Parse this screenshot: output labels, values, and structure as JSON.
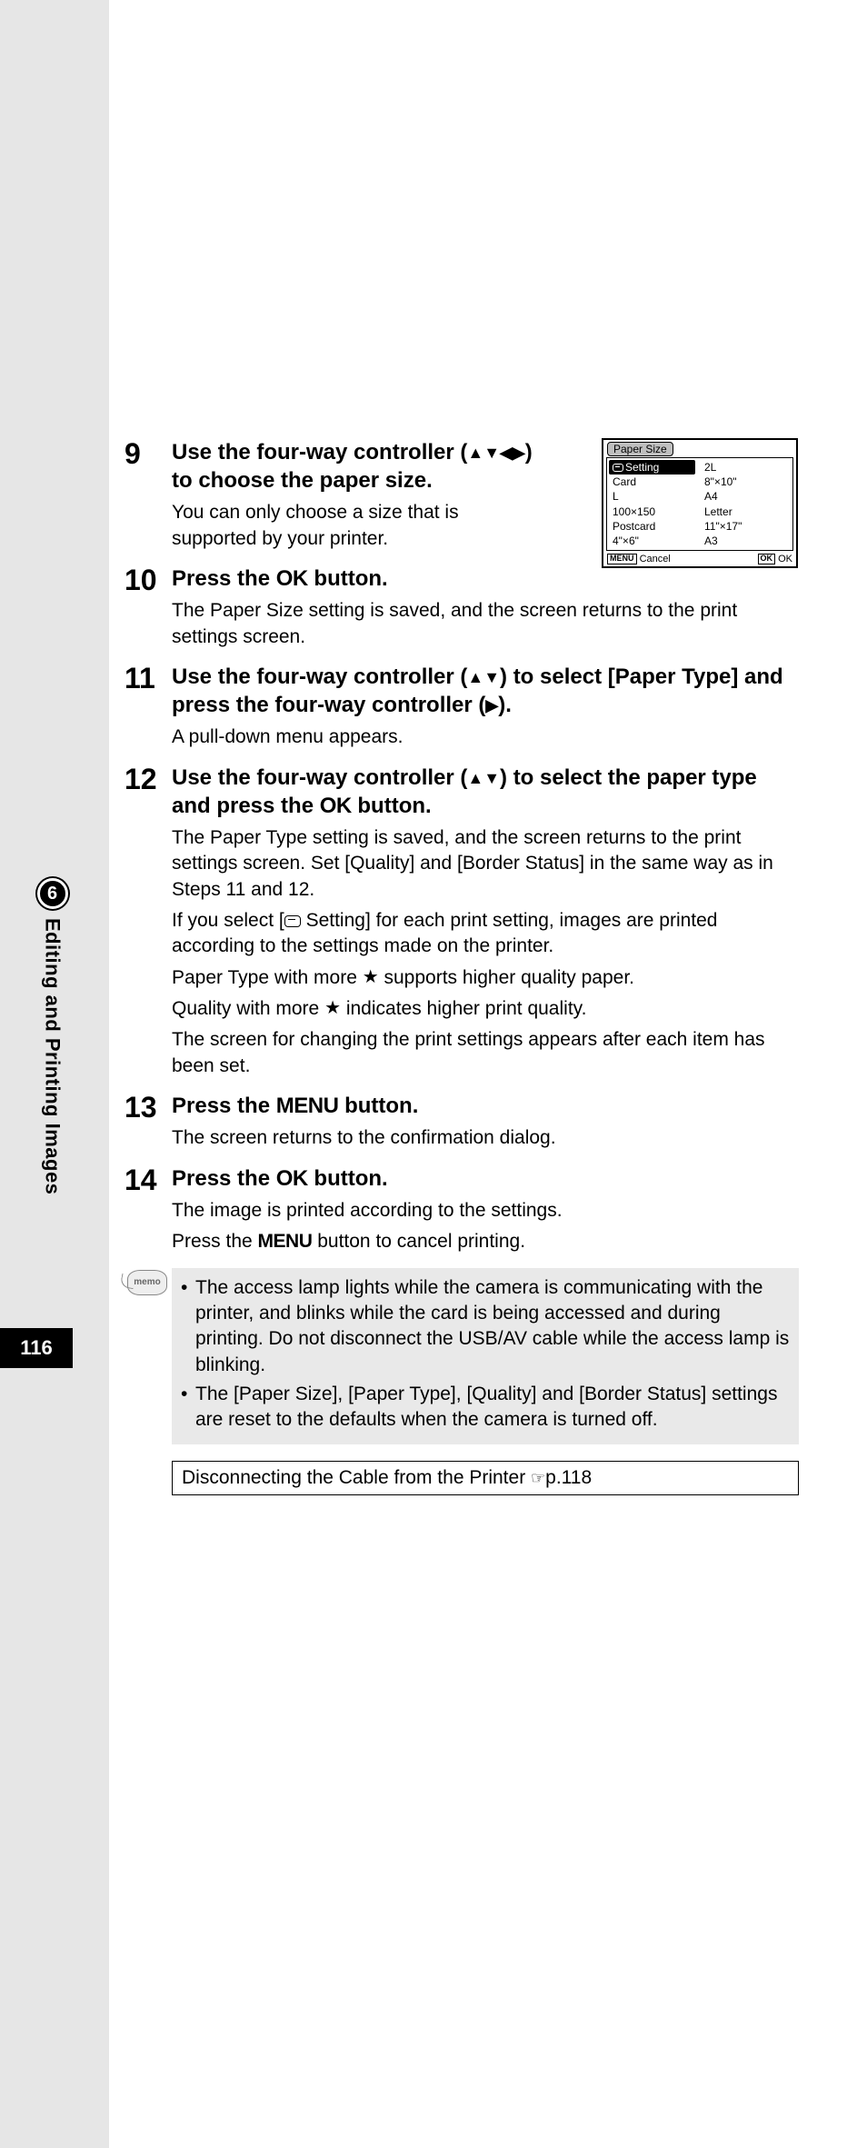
{
  "sidebar": {
    "chapter_number": "6",
    "chapter_title": "Editing and Printing Images"
  },
  "page_number": "116",
  "lcd": {
    "title": "Paper Size",
    "col1": [
      "Setting",
      "Card",
      "L",
      "100×150",
      "Postcard",
      "4\"×6\""
    ],
    "col2": [
      "2L",
      "8\"×10\"",
      "A4",
      "Letter",
      "11\"×17\"",
      "A3"
    ],
    "footer_left_btn": "MENU",
    "footer_left_label": "Cancel",
    "footer_right_btn": "OK",
    "footer_right_label": "OK"
  },
  "steps": {
    "s9": {
      "num": "9",
      "title_a": "Use the four-way controller (",
      "title_arrows": "▲▼◀▶",
      "title_b": ") to choose the paper size.",
      "desc": "You can only choose a size that is supported by your printer."
    },
    "s10": {
      "num": "10",
      "title_a": "Press the ",
      "ok": "OK",
      "title_b": " button.",
      "desc": "The Paper Size setting is saved, and the screen returns to the print settings screen."
    },
    "s11": {
      "num": "11",
      "title_a": "Use the four-way controller (",
      "arrows1": "▲▼",
      "title_b": ") to select [Paper Type] and press the four-way controller (",
      "arrows2": "▶",
      "title_c": ").",
      "desc": "A pull-down menu appears."
    },
    "s12": {
      "num": "12",
      "title_a": "Use the four-way controller (",
      "arrows1": "▲▼",
      "title_b": ") to select the paper type and press the ",
      "ok": "OK",
      "title_c": " button.",
      "desc1": "The Paper Type setting is saved, and the screen returns to the print settings screen. Set [Quality] and [Border Status] in the same way as in Steps 11 and 12.",
      "desc2a": "If you select [",
      "desc2b": " Setting] for each print setting, images are printed according to the settings made on the printer.",
      "desc3a": "Paper Type with more ",
      "desc3b": " supports higher quality paper.",
      "desc4a": "Quality with more ",
      "desc4b": " indicates higher print quality.",
      "desc5": "The screen for changing the print settings appears after each item has been set."
    },
    "s13": {
      "num": "13",
      "title_a": "Press the ",
      "menu": "MENU",
      "title_b": " button.",
      "desc": "The screen returns to the confirmation dialog."
    },
    "s14": {
      "num": "14",
      "title_a": "Press the ",
      "ok": "OK",
      "title_b": " button.",
      "desc1": "The image is printed according to the settings.",
      "desc2a": "Press the ",
      "menu": "MENU",
      "desc2b": " button to cancel printing."
    }
  },
  "memo": {
    "label": "memo",
    "item1": "The access lamp lights while the camera is communicating with the printer, and blinks while the card is being accessed and during printing. Do not disconnect the USB/AV cable while the access lamp is blinking.",
    "item2": "The [Paper Size], [Paper Type], [Quality] and [Border Status] settings are reset to the defaults when the camera is turned off."
  },
  "refbox": {
    "text_a": "Disconnecting the Cable from the Printer ",
    "pointer": "☞",
    "text_b": "p.118"
  }
}
